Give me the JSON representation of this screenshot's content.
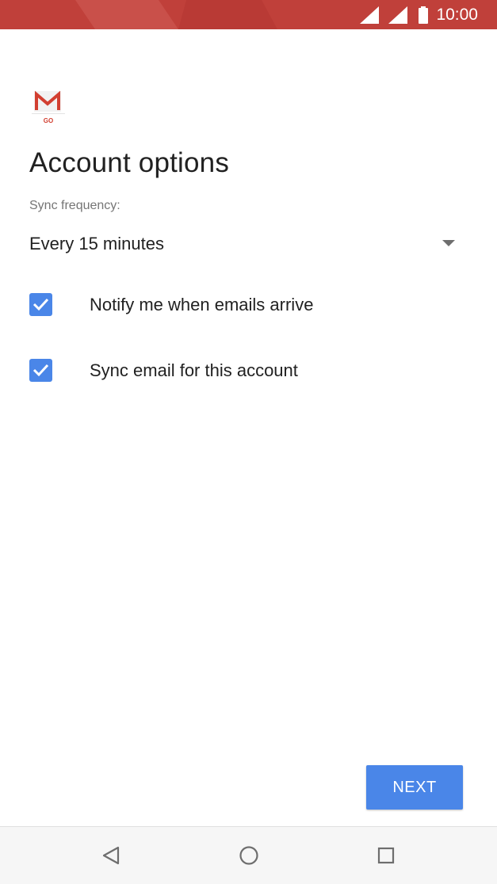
{
  "status_bar": {
    "time": "10:00",
    "background_color": "#c0403a",
    "icons": [
      "signal-icon",
      "signal-icon",
      "battery-icon"
    ]
  },
  "app": {
    "logo_icon": "gmail-go-logo",
    "logo_text": "GO"
  },
  "page": {
    "title": "Account options"
  },
  "sync": {
    "label": "Sync frequency:",
    "selected_value": "Every 15 minutes"
  },
  "options": [
    {
      "label": "Notify me when emails arrive",
      "checked": true
    },
    {
      "label": "Sync email for this account",
      "checked": true
    }
  ],
  "actions": {
    "next_label": "NEXT"
  },
  "navigation": {
    "back_icon": "back-triangle-icon",
    "home_icon": "home-circle-icon",
    "recents_icon": "recents-square-icon"
  },
  "colors": {
    "accent": "#4a86e8",
    "status_bar": "#c0403a"
  }
}
